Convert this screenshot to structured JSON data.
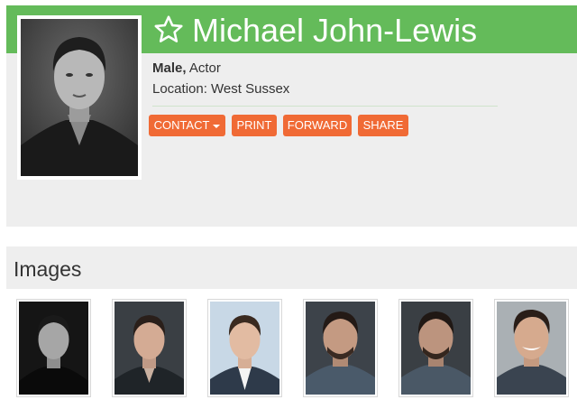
{
  "profile": {
    "name": "Michael John-Lewis",
    "gender": "Male,",
    "profession": "Actor",
    "location": "Location: West Sussex"
  },
  "actions": {
    "contact": "CONTACT",
    "print": "PRINT",
    "forward": "FORWARD",
    "share": "SHARE"
  },
  "images_section": {
    "title": "Images",
    "thumbnails": [
      {
        "style": "black-and-white",
        "background": "#151515"
      },
      {
        "style": "color",
        "background": "#3a3f44"
      },
      {
        "style": "color",
        "background": "#c8d8e6"
      },
      {
        "style": "color",
        "background": "#3d434a"
      },
      {
        "style": "color",
        "background": "#3a3f44"
      },
      {
        "style": "color",
        "background": "#aab0b4"
      }
    ]
  },
  "colors": {
    "name_bar": "#64bb5a",
    "button": "#f06a35",
    "panel": "#eeeeee"
  },
  "icons": {
    "favourite": "star-outline-icon",
    "contact_dropdown": "caret-down-icon"
  }
}
